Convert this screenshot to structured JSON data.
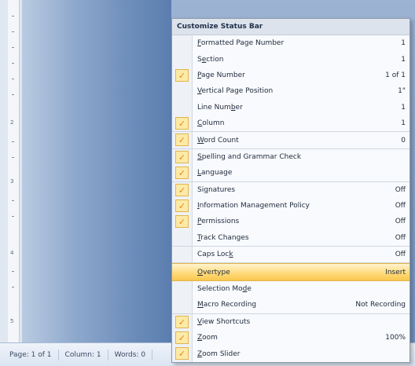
{
  "ruler": {
    "numbers": [
      "2",
      "3",
      "4",
      "5"
    ]
  },
  "status_bar": {
    "page": "Page: 1 of 1",
    "column": "Column: 1",
    "words": "Words: 0"
  },
  "menu": {
    "title": "Customize Status Bar",
    "items": [
      {
        "pre": "",
        "mn": "F",
        "post": "ormatted Page Number",
        "value": "1",
        "checked": false
      },
      {
        "pre": "S",
        "mn": "e",
        "post": "ction",
        "value": "1",
        "checked": false
      },
      {
        "pre": "",
        "mn": "P",
        "post": "age Number",
        "value": "1 of 1",
        "checked": true
      },
      {
        "pre": "",
        "mn": "V",
        "post": "ertical Page Position",
        "value": "1\"",
        "checked": false
      },
      {
        "pre": "Line Num",
        "mn": "b",
        "post": "er",
        "value": "1",
        "checked": false
      },
      {
        "pre": "",
        "mn": "C",
        "post": "olumn",
        "value": "1",
        "checked": true
      },
      {
        "pre": "",
        "mn": "W",
        "post": "ord Count",
        "value": "0",
        "checked": true
      },
      {
        "pre": "",
        "mn": "S",
        "post": "pelling and Grammar Check",
        "value": "",
        "checked": true
      },
      {
        "pre": "",
        "mn": "L",
        "post": "anguage",
        "value": "",
        "checked": true
      },
      {
        "pre": "Si",
        "mn": "g",
        "post": "natures",
        "value": "Off",
        "checked": true
      },
      {
        "pre": "",
        "mn": "I",
        "post": "nformation Management Policy",
        "value": "Off",
        "checked": true
      },
      {
        "pre": "",
        "mn": "P",
        "post": "ermissions",
        "value": "Off",
        "checked": true
      },
      {
        "pre": "",
        "mn": "T",
        "post": "rack Changes",
        "value": "Off",
        "checked": false
      },
      {
        "pre": "Caps Loc",
        "mn": "k",
        "post": "",
        "value": "Off",
        "checked": false
      },
      {
        "pre": "",
        "mn": "O",
        "post": "vertype",
        "value": "Insert",
        "checked": false
      },
      {
        "pre": "Selection Mo",
        "mn": "d",
        "post": "e",
        "value": "",
        "checked": false
      },
      {
        "pre": "",
        "mn": "M",
        "post": "acro Recording",
        "value": "Not Recording",
        "checked": false
      },
      {
        "pre": "",
        "mn": "V",
        "post": "iew Shortcuts",
        "value": "",
        "checked": true
      },
      {
        "pre": "",
        "mn": "Z",
        "post": "oom",
        "value": "100%",
        "checked": true
      },
      {
        "pre": "",
        "mn": "Z",
        "post": "oom Slider",
        "value": "",
        "checked": true
      }
    ],
    "check_glyph": "✓",
    "accent_color": "#f9c74c"
  }
}
